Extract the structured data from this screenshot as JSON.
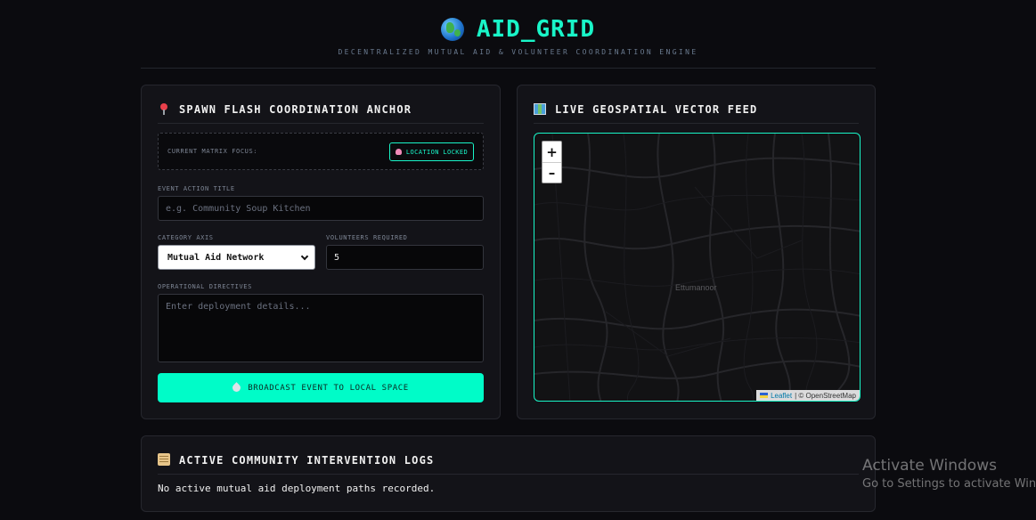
{
  "app": {
    "title": "AID_GRID",
    "subtitle": "DECENTRALIZED MUTUAL AID & VOLUNTEER COORDINATION ENGINE"
  },
  "spawn_panel": {
    "title": "SPAWN FLASH COORDINATION ANCHOR",
    "focus_label": "CURRENT MATRIX FOCUS:",
    "location_badge": "LOCATION LOCKED",
    "event_title_label": "EVENT ACTION TITLE",
    "event_title_placeholder": "e.g. Community Soup Kitchen",
    "event_title_value": "",
    "category_label": "CATEGORY AXIS",
    "category_selected": "Mutual Aid Network",
    "volunteers_label": "VOLUNTEERS REQUIRED",
    "volunteers_value": "5",
    "directives_label": "OPERATIONAL DIRECTIVES",
    "directives_placeholder": "Enter deployment details...",
    "broadcast_button": "BROADCAST EVENT TO LOCAL SPACE"
  },
  "map_panel": {
    "title": "LIVE GEOSPATIAL VECTOR FEED",
    "zoom_in": "+",
    "zoom_out": "–",
    "place_label": "Ettumanoor",
    "attribution_leaflet": "Leaflet",
    "attribution_rest": "| © OpenStreetMap"
  },
  "logs_panel": {
    "title": "ACTIVE COMMUNITY INTERVENTION LOGS",
    "empty_message": "No active mutual aid deployment paths recorded."
  },
  "windows_watermark": {
    "line1": "Activate Windows",
    "line2": "Go to Settings to activate Windows."
  },
  "colors": {
    "accent": "#19f5c8",
    "background": "#0b0b0f",
    "panel": "#131318"
  }
}
